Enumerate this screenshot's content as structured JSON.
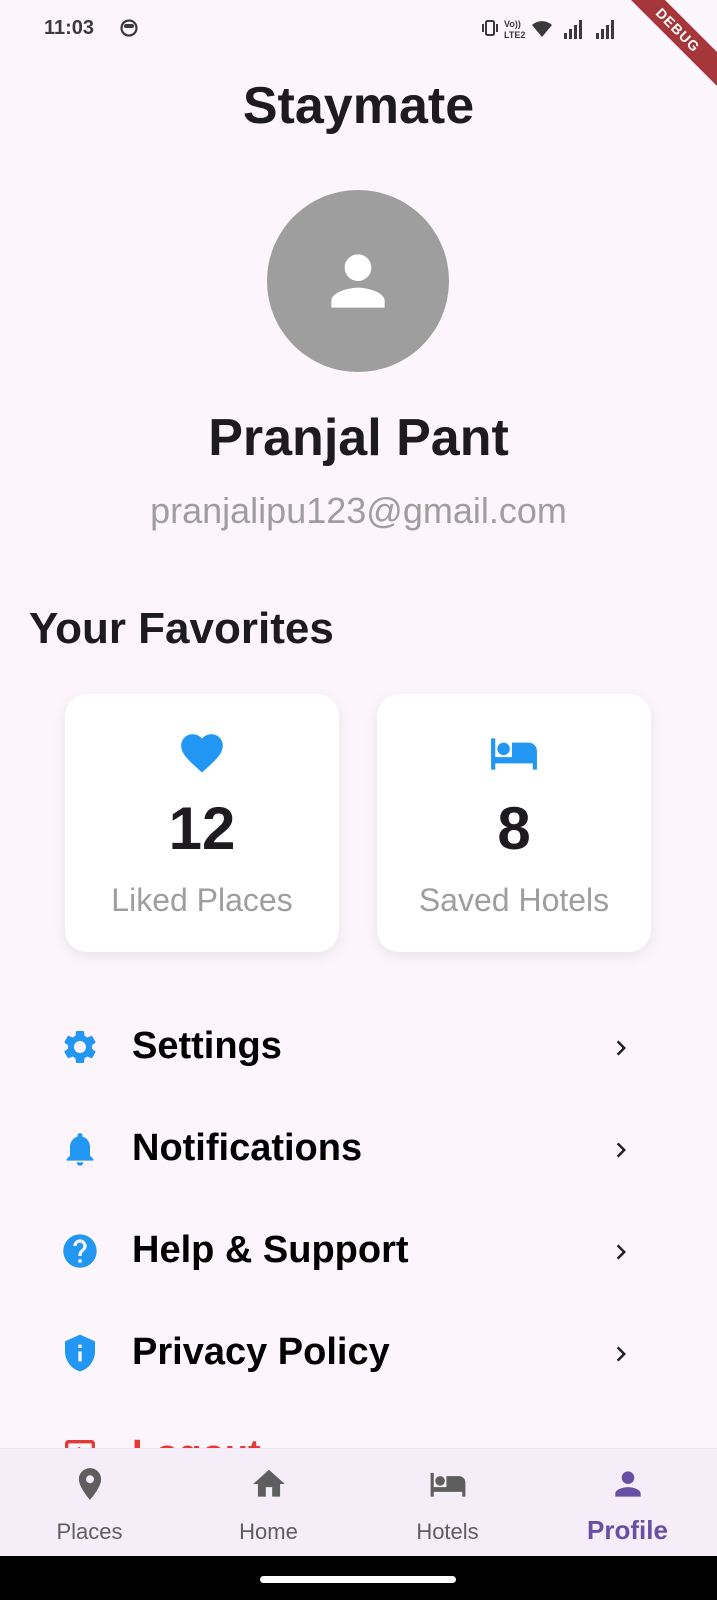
{
  "status_bar": {
    "time": "11:03",
    "debug_label": "DEBUG",
    "network_label_top": "Vo))",
    "network_label_bottom": "LTE2"
  },
  "app": {
    "title": "Staymate"
  },
  "profile": {
    "name": "Pranjal Pant",
    "email": "pranjalipu123@gmail.com",
    "avatar_icon": "person-icon"
  },
  "favorites": {
    "title": "Your Favorites",
    "cards": [
      {
        "icon": "heart-icon",
        "count": "12",
        "label": "Liked Places"
      },
      {
        "icon": "bed-icon",
        "count": "8",
        "label": "Saved Hotels"
      }
    ]
  },
  "menu": {
    "items": [
      {
        "icon": "gear-icon",
        "label": "Settings"
      },
      {
        "icon": "bell-icon",
        "label": "Notifications"
      },
      {
        "icon": "help-icon",
        "label": "Help & Support"
      },
      {
        "icon": "shield-icon",
        "label": "Privacy Policy"
      },
      {
        "icon": "logout-icon",
        "label": "Logout"
      }
    ]
  },
  "bottom_nav": {
    "items": [
      {
        "icon": "location-pin-icon",
        "label": "Places"
      },
      {
        "icon": "home-icon",
        "label": "Home"
      },
      {
        "icon": "bed-icon",
        "label": "Hotels"
      },
      {
        "icon": "person-icon",
        "label": "Profile",
        "active": true
      }
    ]
  },
  "colors": {
    "background": "#FCF6FC",
    "accent_blue": "#2196F3",
    "active_nav": "#6750A4",
    "logout_red": "#E53935",
    "muted_text": "#9E9E9E",
    "avatar_bg": "#9E9E9E",
    "debug_banner": "#A5373B"
  }
}
